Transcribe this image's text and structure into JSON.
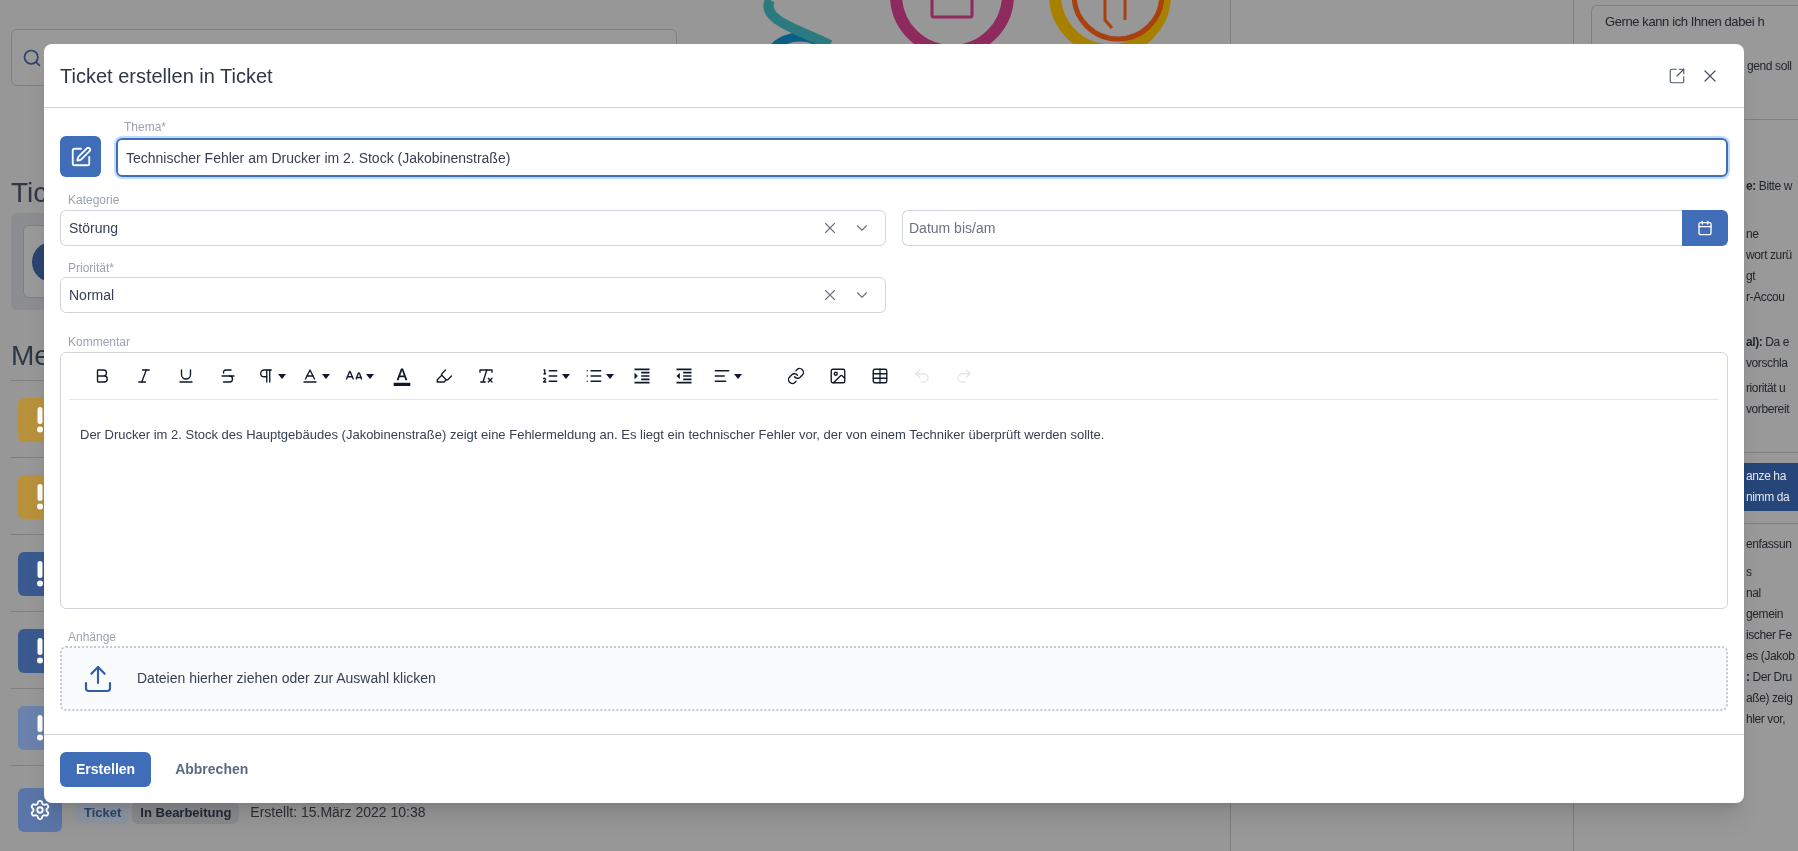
{
  "background": {
    "section_titles": [
      "Tic",
      "Me"
    ],
    "alerts": [
      {
        "kind": "warning",
        "color": "#b8913c"
      },
      {
        "kind": "warning",
        "color": "#b8913c"
      },
      {
        "kind": "warning",
        "color": "#3a5a8f"
      },
      {
        "kind": "warning",
        "color": "#3a5a8f"
      },
      {
        "kind": "warning",
        "color": "#6a82ac"
      },
      {
        "kind": "settings",
        "color": "#5a76a8"
      }
    ],
    "last_item": {
      "badges": [
        "Ticket",
        "In Bearbeitung"
      ],
      "created": "Erstellt: 15.März 2022 10:38"
    },
    "chat": {
      "message_lines": [
        "Gerne kann ich Ihnen dabei h",
        "gend soll"
      ],
      "blocks": [
        [
          "**e:** Bitte w"
        ],
        [
          "ne",
          "wort zurü",
          "gt",
          "r-Accou"
        ],
        [
          "**al):** Da e",
          "vorschla"
        ],
        [
          "riorität u",
          "vorbereit"
        ]
      ],
      "banner": [
        "anze ha",
        "nimm da"
      ],
      "summary": [
        "enfassun",
        "s",
        "nal",
        "gemein",
        "ischer Fe",
        "es (Jakob",
        "**:** Der Dru",
        "aße) zeig",
        "hler vor,"
      ]
    }
  },
  "dialog": {
    "title": "Ticket erstellen in Ticket",
    "subject": {
      "label": "Thema*",
      "value": "Technischer Fehler am Drucker im 2. Stock (Jakobinenstraße)"
    },
    "category": {
      "label": "Kategorie",
      "value": "Störung"
    },
    "due_date": {
      "placeholder": "Datum bis/am"
    },
    "priority": {
      "label": "Priorität*",
      "value": "Normal"
    },
    "comment": {
      "label": "Kommentar",
      "toolbar": [
        [
          {
            "kind": "bold",
            "dropdown": false,
            "disabled": false
          },
          {
            "kind": "italic",
            "dropdown": false,
            "disabled": false
          },
          {
            "kind": "underline",
            "dropdown": false,
            "disabled": false
          },
          {
            "kind": "strike",
            "dropdown": false,
            "disabled": false
          },
          {
            "kind": "paragraph",
            "dropdown": true,
            "disabled": false
          },
          {
            "kind": "font",
            "dropdown": true,
            "disabled": false
          },
          {
            "kind": "size",
            "dropdown": true,
            "disabled": false
          },
          {
            "kind": "color",
            "dropdown": false,
            "disabled": false
          },
          {
            "kind": "highlight",
            "dropdown": false,
            "disabled": false
          },
          {
            "kind": "clear",
            "dropdown": false,
            "disabled": false
          }
        ],
        [
          {
            "kind": "ordered",
            "dropdown": true,
            "disabled": false
          },
          {
            "kind": "bullets",
            "dropdown": true,
            "disabled": false
          },
          {
            "kind": "indent",
            "dropdown": false,
            "disabled": false
          },
          {
            "kind": "outdent",
            "dropdown": false,
            "disabled": false
          },
          {
            "kind": "align",
            "dropdown": true,
            "disabled": false
          }
        ],
        [
          {
            "kind": "link",
            "dropdown": false,
            "disabled": false
          },
          {
            "kind": "image",
            "dropdown": false,
            "disabled": false
          },
          {
            "kind": "table",
            "dropdown": false,
            "disabled": false
          },
          {
            "kind": "undo",
            "dropdown": false,
            "disabled": true
          },
          {
            "kind": "redo",
            "dropdown": false,
            "disabled": true
          }
        ]
      ],
      "text": "Der Drucker im 2. Stock des Hauptgebäudes (Jakobinenstraße) zeigt eine Fehlermeldung an. Es liegt ein technischer Fehler vor, der von einem Techniker überprüft werden sollte."
    },
    "attachments": {
      "label": "Anhänge",
      "hint": "Dateien hierher ziehen oder zur Auswahl klicken"
    },
    "buttons": [
      {
        "label": "Erstellen",
        "kind": "primary"
      },
      {
        "label": "Abbrechen",
        "kind": "secondary"
      }
    ]
  }
}
